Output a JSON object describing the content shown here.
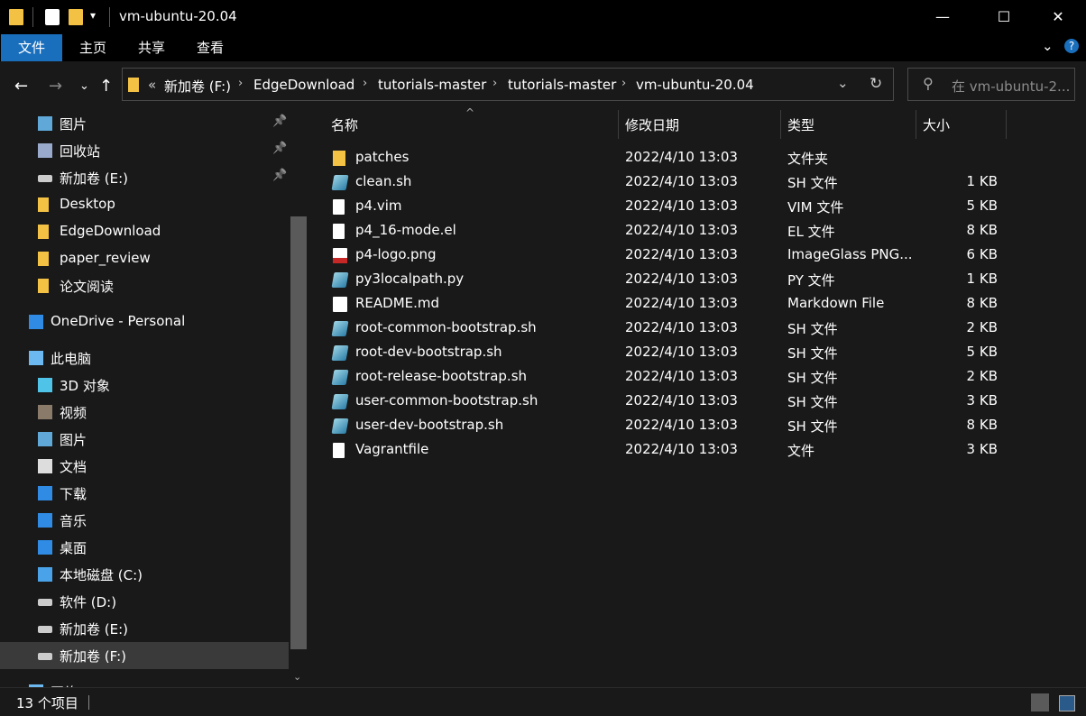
{
  "window": {
    "title": "vm-ubuntu-20.04",
    "minimize": "—",
    "maximize": "☐",
    "close": "✕"
  },
  "ribbon": {
    "tabs": [
      "文件",
      "主页",
      "共享",
      "查看"
    ]
  },
  "address": {
    "crumbs": [
      "新加卷 (F:)",
      "EdgeDownload",
      "tutorials-master",
      "tutorials-master",
      "vm-ubuntu-20.04"
    ],
    "overflow": "«"
  },
  "search": {
    "placeholder": "在 vm-ubuntu-2..."
  },
  "sidebar": {
    "items": [
      {
        "label": "图片",
        "icon": "pictures-icon",
        "pinned": true
      },
      {
        "label": "回收站",
        "icon": "recycle-bin-icon",
        "pinned": true
      },
      {
        "label": "新加卷 (E:)",
        "icon": "drive-icon",
        "pinned": true
      },
      {
        "label": "Desktop",
        "icon": "folder-icon"
      },
      {
        "label": "EdgeDownload",
        "icon": "folder-icon"
      },
      {
        "label": "paper_review",
        "icon": "folder-icon"
      },
      {
        "label": "论文阅读",
        "icon": "folder-icon"
      },
      {
        "label": "OneDrive - Personal",
        "icon": "onedrive-icon"
      },
      {
        "label": "此电脑",
        "icon": "this-pc-icon"
      },
      {
        "label": "3D 对象",
        "icon": "3d-objects-icon"
      },
      {
        "label": "视频",
        "icon": "videos-icon"
      },
      {
        "label": "图片",
        "icon": "pictures-icon"
      },
      {
        "label": "文档",
        "icon": "documents-icon"
      },
      {
        "label": "下载",
        "icon": "downloads-icon"
      },
      {
        "label": "音乐",
        "icon": "music-icon"
      },
      {
        "label": "桌面",
        "icon": "desktop-icon"
      },
      {
        "label": "本地磁盘 (C:)",
        "icon": "windows-drive-icon"
      },
      {
        "label": "软件 (D:)",
        "icon": "drive-icon"
      },
      {
        "label": "新加卷 (E:)",
        "icon": "drive-icon"
      },
      {
        "label": "新加卷 (F:)",
        "icon": "drive-icon",
        "selected": true
      },
      {
        "label": "网络",
        "icon": "network-icon"
      }
    ]
  },
  "columns": {
    "name": "名称",
    "date": "修改日期",
    "type": "类型",
    "size": "大小"
  },
  "files": [
    {
      "name": "patches",
      "date": "2022/4/10 13:03",
      "type": "文件夹",
      "size": "",
      "icon": "folder-icon"
    },
    {
      "name": "clean.sh",
      "date": "2022/4/10 13:03",
      "type": "SH 文件",
      "size": "1 KB",
      "icon": "sh-file-icon"
    },
    {
      "name": "p4.vim",
      "date": "2022/4/10 13:03",
      "type": "VIM 文件",
      "size": "5 KB",
      "icon": "blank-file-icon"
    },
    {
      "name": "p4_16-mode.el",
      "date": "2022/4/10 13:03",
      "type": "EL 文件",
      "size": "8 KB",
      "icon": "blank-file-icon"
    },
    {
      "name": "p4-logo.png",
      "date": "2022/4/10 13:03",
      "type": "ImageGlass PNG...",
      "size": "6 KB",
      "icon": "png-file-icon"
    },
    {
      "name": "py3localpath.py",
      "date": "2022/4/10 13:03",
      "type": "PY 文件",
      "size": "1 KB",
      "icon": "sh-file-icon"
    },
    {
      "name": "README.md",
      "date": "2022/4/10 13:03",
      "type": "Markdown File",
      "size": "8 KB",
      "icon": "md-file-icon"
    },
    {
      "name": "root-common-bootstrap.sh",
      "date": "2022/4/10 13:03",
      "type": "SH 文件",
      "size": "2 KB",
      "icon": "sh-file-icon"
    },
    {
      "name": "root-dev-bootstrap.sh",
      "date": "2022/4/10 13:03",
      "type": "SH 文件",
      "size": "5 KB",
      "icon": "sh-file-icon"
    },
    {
      "name": "root-release-bootstrap.sh",
      "date": "2022/4/10 13:03",
      "type": "SH 文件",
      "size": "2 KB",
      "icon": "sh-file-icon"
    },
    {
      "name": "user-common-bootstrap.sh",
      "date": "2022/4/10 13:03",
      "type": "SH 文件",
      "size": "3 KB",
      "icon": "sh-file-icon"
    },
    {
      "name": "user-dev-bootstrap.sh",
      "date": "2022/4/10 13:03",
      "type": "SH 文件",
      "size": "8 KB",
      "icon": "sh-file-icon"
    },
    {
      "name": "Vagrantfile",
      "date": "2022/4/10 13:03",
      "type": "文件",
      "size": "3 KB",
      "icon": "blank-file-icon"
    }
  ],
  "status": {
    "count": "13 个项目"
  },
  "colors": {
    "accent": "#1a6fbd",
    "background": "#191919",
    "folder": "#f3c244"
  }
}
